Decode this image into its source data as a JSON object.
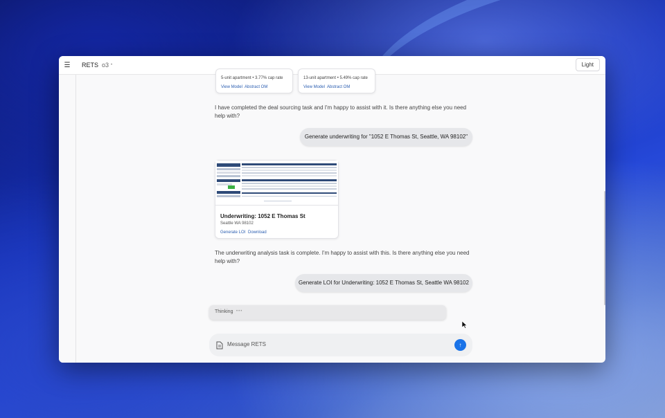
{
  "topbar": {
    "menu_icon": "hamburger-menu-icon",
    "app_title": "RETS",
    "model": "o3",
    "model_caret": "•",
    "theme_button": "Light"
  },
  "deal_cards": [
    {
      "description": "5-unit apartment • 3.77% cap rate",
      "links": [
        "View Model",
        "Abstract OM"
      ]
    },
    {
      "description": "13-unit apartment • 5.49% cap rate",
      "links": [
        "View Model",
        "Abstract OM"
      ]
    }
  ],
  "messages": [
    {
      "role": "assistant",
      "text_line1": "I have completed the deal sourcing task and I'm happy to assist with it. Is there anything else you need",
      "text_line2": "help with?"
    },
    {
      "role": "user",
      "text": "Generate underwriting for \"1052 E Thomas St, Seattle, WA 98102\""
    },
    {
      "role": "assistant",
      "text_line1": "The underwriting analysis task is complete. I'm happy to assist with this. Is there anything else you need",
      "text_line2": "help with?"
    },
    {
      "role": "user",
      "text": "Generate LOI for Underwriting: 1052 E Thomas St, Seattle WA 98102"
    }
  ],
  "underwriting_card": {
    "title": "Underwriting: 1052 E Thomas St",
    "subtitle": "Seattle WA 98102",
    "links": [
      "Generate LOI",
      "Download"
    ]
  },
  "thinking": {
    "label": "Thinking",
    "dots": "•••"
  },
  "composer": {
    "placeholder": "Message RETS",
    "attach_icon": "document-icon",
    "send_icon": "arrow-up-icon",
    "send_glyph": "↑"
  },
  "colors": {
    "accent": "#1a73e8",
    "link": "#2a5db0",
    "bubble": "#e6e7ea",
    "window_bg": "#f9f9fa"
  }
}
